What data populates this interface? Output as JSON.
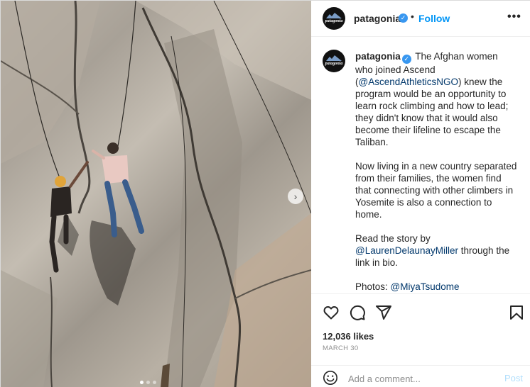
{
  "header": {
    "username": "patagonia",
    "follow_label": "Follow",
    "separator": "•",
    "more_label": "•••"
  },
  "avatar": {
    "logo_text": "patagonia"
  },
  "caption": {
    "username": "patagonia",
    "para1_before": " The Afghan women who joined Ascend (",
    "para1_mention": "@AscendAthleticsNGO",
    "para1_after": ") knew the program would be an opportunity to learn rock climbing and how to lead; they didn't know that it would also become their lifeline to escape the Taliban.",
    "para2": "Now living in a new country separated from their families, the women find that connecting with other climbers in Yosemite is also a connection to home.",
    "para3_before": "Read the story by ",
    "para3_mention": "@LaurenDelaunayMiller",
    "para3_after": " through the link in bio.",
    "para4_before": "Photos: ",
    "para4_mention": "@MiyaTsudome"
  },
  "engagement": {
    "likes": "12,036 likes",
    "date": "MARCH 30"
  },
  "comment": {
    "placeholder": "Add a comment...",
    "post_label": "Post"
  },
  "carousel": {
    "next_glyph": "›"
  },
  "colors": {
    "follow_blue": "#0095f6",
    "verified_blue": "#3897f0",
    "mention": "#00376b",
    "post_disabled": "#b2dffc"
  },
  "icons": [
    "heart-icon",
    "comment-icon",
    "share-icon",
    "bookmark-icon",
    "emoji-icon",
    "verified-icon",
    "chevron-right-icon",
    "more-icon"
  ]
}
